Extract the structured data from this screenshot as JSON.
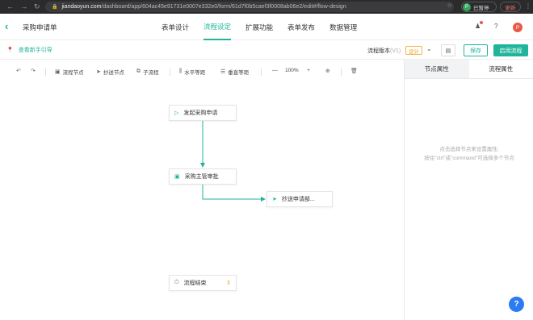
{
  "browser": {
    "url_host": "jiandaoyun.com",
    "url_path": "/dashboard/app/604ac45e91731e0007e332e0/form/61d7f0b5caef3f0008ab06e2/edit#/flow-design",
    "profile_initial": "P",
    "profile_label": "已暂停",
    "update_label": "更新"
  },
  "header": {
    "form_title": "采购申请单",
    "tabs": [
      "表单设计",
      "流程设定",
      "扩展功能",
      "表单发布",
      "数据管理"
    ],
    "active_tab": "流程设定",
    "avatar_initial": "P"
  },
  "subbar": {
    "guide_link": "查看新手引导",
    "version_label": "流程版本",
    "version_number": "(V1)",
    "status_tag": "设计",
    "save_button": "保存",
    "enable_button": "启用流程"
  },
  "toolbar": {
    "flow_node": "流程节点",
    "cc_node": "抄送节点",
    "sub_flow": "子流程",
    "h_align": "水平等距",
    "v_align": "垂直等距",
    "zoom": "100%"
  },
  "nodes": {
    "start": "发起采购申请",
    "approve": "采购主管审批",
    "cc": "抄送申请部...",
    "end": "流程结束"
  },
  "panel": {
    "tab_node": "节点属性",
    "tab_flow": "流程属性",
    "hint_line1": "点击选择节点来设置属性;",
    "hint_line2": "按住\"ctrl\"或\"command\"可选择多个节点"
  },
  "colors": {
    "accent": "#1fb59a",
    "status": "#f0a020",
    "help": "#2b7bf3"
  }
}
